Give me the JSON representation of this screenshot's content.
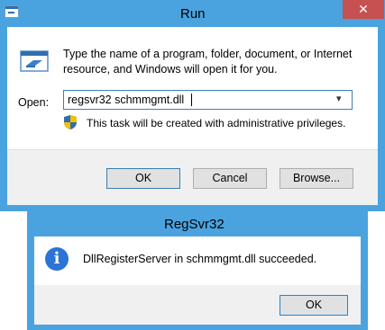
{
  "run": {
    "title": "Run",
    "close_glyph": "✕",
    "prompt": "Type the name of a program, folder, document, or Internet resource, and Windows will open it for you.",
    "open_label": "Open:",
    "open_value": "regsvr32 schmmgmt.dll",
    "dropdown_glyph": "▾",
    "admin_note": "This task will be created with administrative privileges.",
    "buttons": {
      "ok": "OK",
      "cancel": "Cancel",
      "browse": "Browse..."
    },
    "colors": {
      "frame": "#4aa3df",
      "close": "#c75050"
    },
    "icons": [
      "run-app-icon",
      "close-icon",
      "run-program-icon",
      "uac-shield-icon",
      "chevron-down-icon"
    ]
  },
  "regsvr": {
    "title": "RegSvr32",
    "message": "DllRegisterServer in schmmgmt.dll succeeded.",
    "info_glyph": "i",
    "ok_label": "OK",
    "colors": {
      "frame": "#4aa3df",
      "info": "#2b73d6"
    },
    "icons": [
      "information-icon"
    ]
  }
}
